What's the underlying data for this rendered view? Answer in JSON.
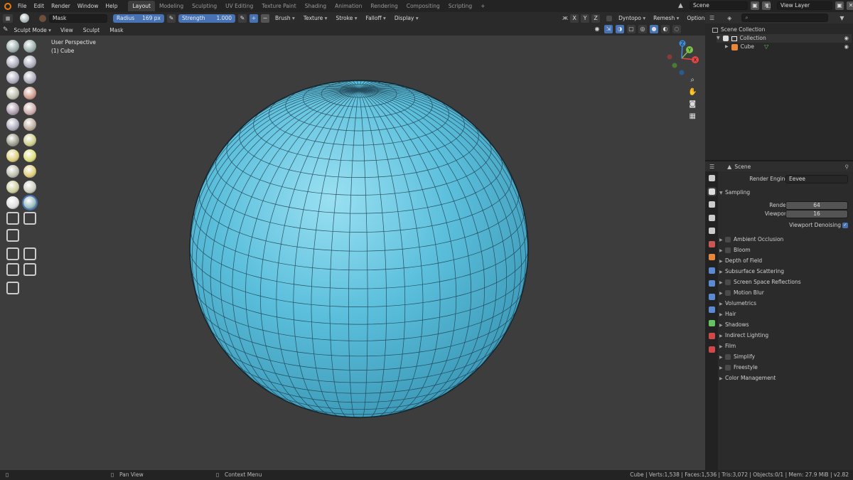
{
  "topbar": {
    "menus": [
      "File",
      "Edit",
      "Render",
      "Window",
      "Help"
    ],
    "workspaces": [
      "Layout",
      "Modeling",
      "Sculpting",
      "UV Editing",
      "Texture Paint",
      "Shading",
      "Animation",
      "Rendering",
      "Compositing",
      "Scripting"
    ],
    "active_workspace": "Layout",
    "add_workspace": "+",
    "scene": "Scene",
    "view_layer": "View Layer"
  },
  "tool_header": {
    "brush_name": "Mask",
    "radius_label": "Radius",
    "radius_value": "169 px",
    "strength_label": "Strength",
    "strength_value": "1.000",
    "plus": "+",
    "minus": "−",
    "brush_menu": "Brush",
    "texture_menu": "Texture",
    "stroke_menu": "Stroke",
    "falloff_menu": "Falloff",
    "display_menu": "Display",
    "axes": [
      "X",
      "Y",
      "Z"
    ],
    "dyntopo": "Dyntopo",
    "remesh": "Remesh",
    "options": "Options"
  },
  "viewport_header": {
    "mode": "Sculpt Mode",
    "menus": [
      "View",
      "Sculpt",
      "Mask"
    ]
  },
  "viewport": {
    "perspective": "User Perspective",
    "object": "(1) Cube",
    "gizmo_labels": {
      "x": "X",
      "y": "Y",
      "z": "Z"
    }
  },
  "outliner": {
    "search_placeholder": "",
    "root": "Scene Collection",
    "collection": "Collection",
    "object": "Cube"
  },
  "properties": {
    "scene_label": "Scene",
    "render_engine_label": "Render Engine",
    "render_engine": "Eevee",
    "sampling_title": "Sampling",
    "render_label": "Render",
    "render_samples": "64",
    "viewport_label": "Viewport",
    "viewport_samples": "16",
    "viewport_denoising": "Viewport Denoising",
    "panels": [
      {
        "label": "Ambient Occlusion",
        "checkbox": true
      },
      {
        "label": "Bloom",
        "checkbox": true
      },
      {
        "label": "Depth of Field",
        "checkbox": false
      },
      {
        "label": "Subsurface Scattering",
        "checkbox": false
      },
      {
        "label": "Screen Space Reflections",
        "checkbox": true
      },
      {
        "label": "Motion Blur",
        "checkbox": true
      },
      {
        "label": "Volumetrics",
        "checkbox": false
      },
      {
        "label": "Hair",
        "checkbox": false
      },
      {
        "label": "Shadows",
        "checkbox": false
      },
      {
        "label": "Indirect Lighting",
        "checkbox": false
      },
      {
        "label": "Film",
        "checkbox": false
      },
      {
        "label": "Simplify",
        "checkbox": true
      },
      {
        "label": "Freestyle",
        "checkbox": true
      },
      {
        "label": "Color Management",
        "checkbox": false
      }
    ]
  },
  "statusbar": {
    "left_hint": "Pan View",
    "right_hint": "Context Menu",
    "stats": "Cube | Verts:1,538 | Faces:1,536 | Tris:3,072 | Objects:0/1 | Mem: 27.9 MiB | v2.82"
  },
  "colors": {
    "accent": "#4772b3",
    "viewport_bg": "#3d3d3d",
    "mesh": "#5bbfdc",
    "gizmo_x": "#e84545",
    "gizmo_y": "#7cc44b",
    "gizmo_z": "#3c8ee0"
  }
}
